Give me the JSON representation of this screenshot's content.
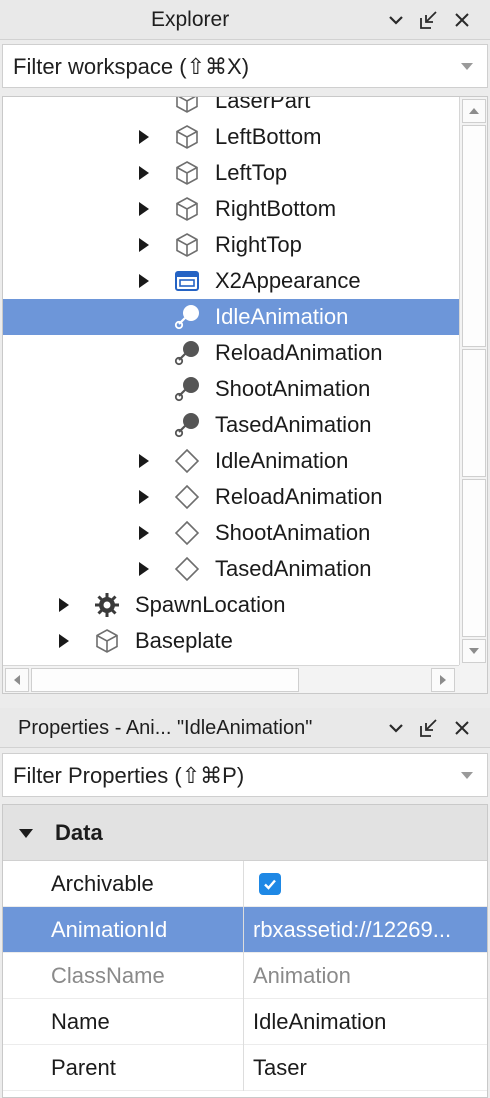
{
  "explorer": {
    "title": "Explorer",
    "filter_placeholder": "Filter workspace (⇧⌘X)",
    "items": [
      {
        "label": "LaserPart",
        "icon": "part-icon",
        "expandable": false
      },
      {
        "label": "LeftBottom",
        "icon": "part-icon",
        "expandable": true
      },
      {
        "label": "LeftTop",
        "icon": "part-icon",
        "expandable": true
      },
      {
        "label": "RightBottom",
        "icon": "part-icon",
        "expandable": true
      },
      {
        "label": "RightTop",
        "icon": "part-icon",
        "expandable": true
      },
      {
        "label": "X2Appearance",
        "icon": "appearance-icon",
        "expandable": true
      },
      {
        "label": "IdleAnimation",
        "icon": "animation-icon",
        "expandable": false,
        "selected": true
      },
      {
        "label": "ReloadAnimation",
        "icon": "animation-icon",
        "expandable": false
      },
      {
        "label": "ShootAnimation",
        "icon": "animation-icon",
        "expandable": false
      },
      {
        "label": "TasedAnimation",
        "icon": "animation-icon",
        "expandable": false
      },
      {
        "label": "IdleAnimation",
        "icon": "diamond-icon",
        "expandable": true
      },
      {
        "label": "ReloadAnimation",
        "icon": "diamond-icon",
        "expandable": true
      },
      {
        "label": "ShootAnimation",
        "icon": "diamond-icon",
        "expandable": true
      },
      {
        "label": "TasedAnimation",
        "icon": "diamond-icon",
        "expandable": true
      },
      {
        "label": "SpawnLocation",
        "icon": "spawn-gear-icon",
        "expandable": true
      },
      {
        "label": "Baseplate",
        "icon": "part-icon",
        "expandable": true
      }
    ]
  },
  "properties": {
    "title": "Properties - Ani... \"IdleAnimation\"",
    "filter_placeholder": "Filter Properties (⇧⌘P)",
    "section": "Data",
    "rows": [
      {
        "name": "Archivable",
        "value": "",
        "checked": true
      },
      {
        "name": "AnimationId",
        "value": "rbxassetid://12269...",
        "selected": true
      },
      {
        "name": "ClassName",
        "value": "Animation",
        "readonly": true
      },
      {
        "name": "Name",
        "value": "IdleAnimation"
      },
      {
        "name": "Parent",
        "value": "Taser"
      }
    ]
  },
  "colors": {
    "selection": "#6d96d9",
    "checkbox": "#1e88e5"
  }
}
